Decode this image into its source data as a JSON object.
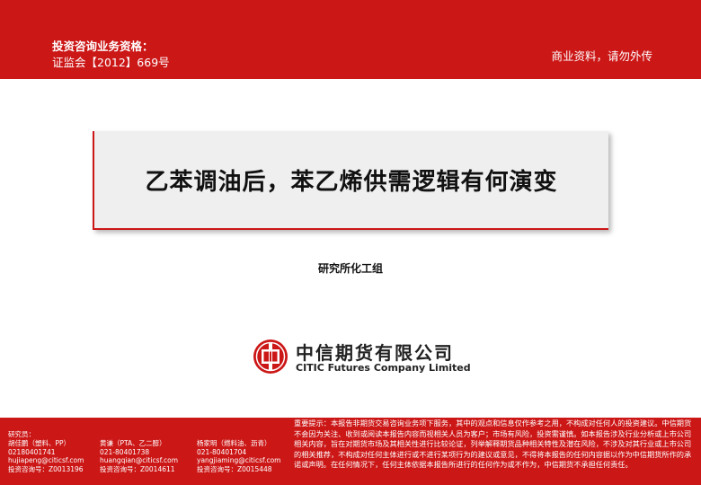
{
  "header": {
    "qualification_title": "投资咨询业务资格：",
    "qualification_number": "证监会【2012】669号",
    "confidential_notice": "商业资料，请勿外传"
  },
  "report": {
    "title": "乙苯调油后，苯乙烯供需逻辑有何演变",
    "group": "研究所化工组"
  },
  "company": {
    "name_cn": "中信期货有限公司",
    "name_en": "CITIC Futures Company Limited"
  },
  "footer": {
    "researchers_label": "研究员：",
    "analysts": [
      {
        "name": "胡佳鹏（塑料、PP）",
        "phone": "02180401741",
        "email": "hujiapeng@citicsf.com",
        "license": "投资咨询号：Z0013196"
      },
      {
        "name": "黄谦（PTA、乙二醇）",
        "phone": "021-80401738",
        "email": "huangqian@citicsf.com",
        "license": "投资咨询号：Z0014611"
      },
      {
        "name": "杨家明（燃料油、沥青）",
        "phone": "021-80401704",
        "email": "yangjiaming@citicsf.com",
        "license": "投资咨询号：Z0015448"
      }
    ],
    "disclaimer": "重要提示：本报告非期货交易咨询业务项下服务，其中的观点和信息仅作参考之用，不构成对任何人的投资建议。中信期货不会因为关注、收到或阅读本报告内容而视相关人员为客户；市场有风险，投资需谨慎。如本报告涉及行业分析或上市公司相关内容，旨在对期货市场及其相关性进行比较论证，列举解释期货品种相关特性及潜在风险，不涉及对其行业或上市公司的相关推荐，不构成对任何主体进行或不进行某项行为的建议或意见，不得将本报告的任何内容据以作为中信期货所作的承诺或声明。在任何情况下，任何主体依据本报告所进行的任何作为或不作为，中信期货不承担任何责任。"
  },
  "colors": {
    "brand_red": "#cc1717",
    "title_box_bg": "#efefef"
  }
}
